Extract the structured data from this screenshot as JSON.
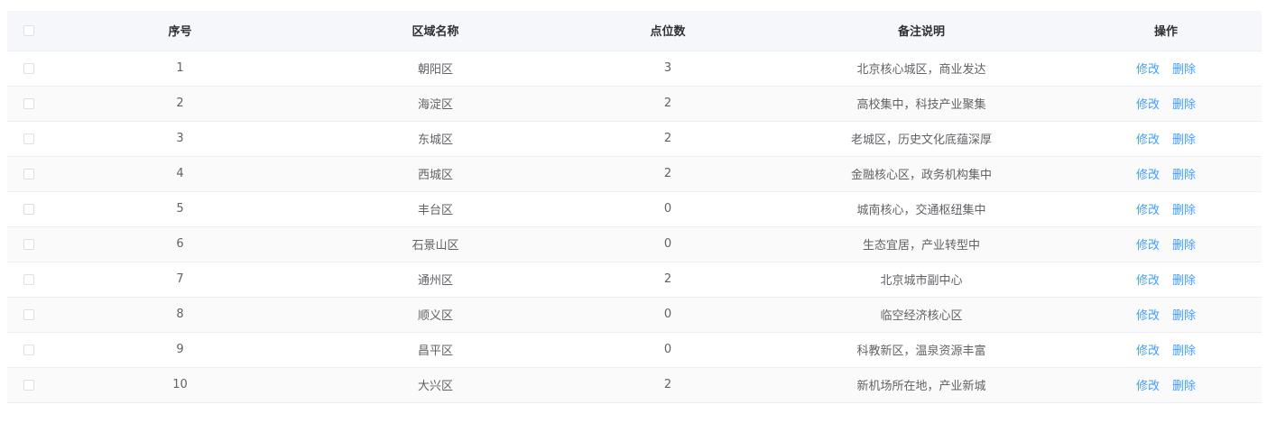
{
  "table": {
    "columns": {
      "index": "序号",
      "name": "区域名称",
      "count": "点位数",
      "remark": "备注说明",
      "actions": "操作"
    },
    "action_labels": {
      "edit": "修改",
      "delete": "删除"
    },
    "rows": [
      {
        "index": "1",
        "name": "朝阳区",
        "count": "3",
        "remark": "北京核心城区，商业发达"
      },
      {
        "index": "2",
        "name": "海淀区",
        "count": "2",
        "remark": "高校集中，科技产业聚集"
      },
      {
        "index": "3",
        "name": "东城区",
        "count": "2",
        "remark": "老城区，历史文化底蕴深厚"
      },
      {
        "index": "4",
        "name": "西城区",
        "count": "2",
        "remark": "金融核心区，政务机构集中"
      },
      {
        "index": "5",
        "name": "丰台区",
        "count": "0",
        "remark": "城南核心，交通枢纽集中"
      },
      {
        "index": "6",
        "name": "石景山区",
        "count": "0",
        "remark": "生态宜居，产业转型中"
      },
      {
        "index": "7",
        "name": "通州区",
        "count": "2",
        "remark": "北京城市副中心"
      },
      {
        "index": "8",
        "name": "顺义区",
        "count": "0",
        "remark": "临空经济核心区"
      },
      {
        "index": "9",
        "name": "昌平区",
        "count": "0",
        "remark": "科教新区，温泉资源丰富"
      },
      {
        "index": "10",
        "name": "大兴区",
        "count": "2",
        "remark": "新机场所在地，产业新城"
      }
    ]
  },
  "colors": {
    "link": "#409eff",
    "header_bg": "#f5f7fa",
    "border": "#ebeef5",
    "text": "#606266"
  }
}
